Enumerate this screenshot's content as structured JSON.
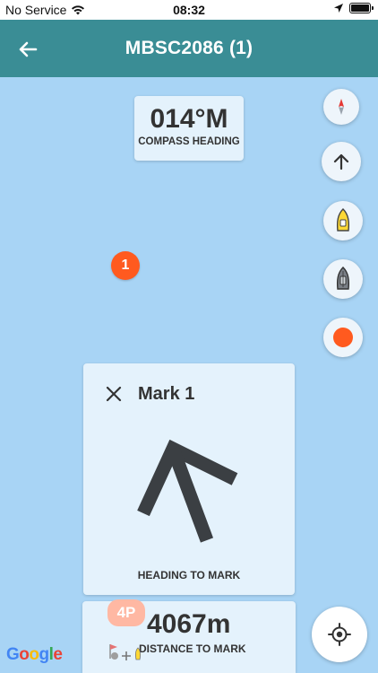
{
  "status_bar": {
    "carrier": "No Service",
    "time": "08:32"
  },
  "header": {
    "title": "MBSC2086 (1)"
  },
  "compass": {
    "value": "014°M",
    "label": "COMPASS HEADING"
  },
  "map_marker": {
    "label": "1",
    "color": "#ff5a1f"
  },
  "side_buttons": [
    {
      "name": "compass-icon"
    },
    {
      "name": "arrow-up-icon"
    },
    {
      "name": "yellow-boat-icon"
    },
    {
      "name": "grey-boat-icon"
    },
    {
      "name": "record-dot-icon"
    }
  ],
  "mark_panel": {
    "title": "Mark 1",
    "heading_label": "HEADING TO MARK"
  },
  "distance_panel": {
    "value": "4067m",
    "label": "DISTANCE TO MARK",
    "badge": "4P"
  },
  "map_attribution": {
    "letters": [
      "G",
      "o",
      "o",
      "g",
      "l",
      "e"
    ]
  },
  "colors": {
    "header": "#3a8d95",
    "water": "#a8d4f5",
    "card": "#e4f2fc",
    "accent": "#ff5a1f"
  }
}
